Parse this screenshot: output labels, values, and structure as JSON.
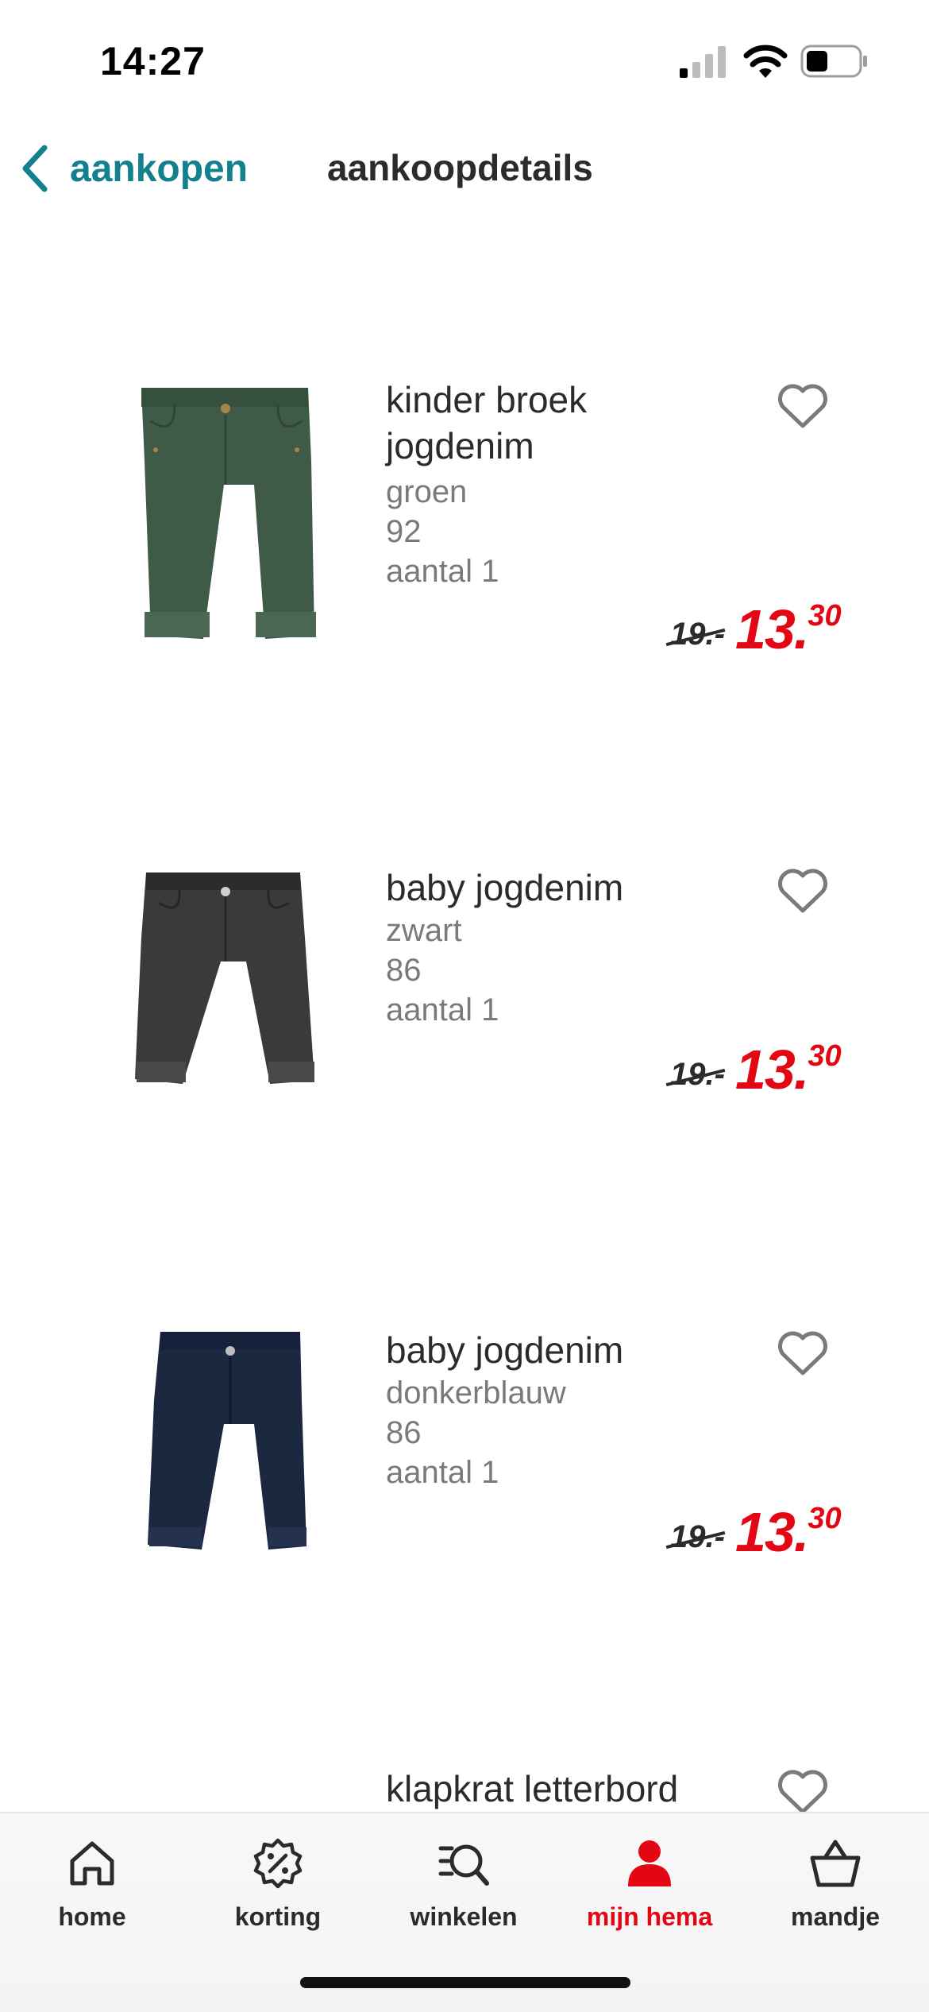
{
  "status_bar": {
    "time": "14:27"
  },
  "nav": {
    "back_label": "aankopen",
    "title": "aankoopdetails"
  },
  "items": [
    {
      "name": "kinder broek jogdenim",
      "color": "groen",
      "size": "92",
      "quantity": "aantal 1",
      "old_price": "19.-",
      "price_int": "13.",
      "price_dec": "30",
      "image": "green-jeans"
    },
    {
      "name": "baby jogdenim",
      "color": "zwart",
      "size": "86",
      "quantity": "aantal 1",
      "old_price": "19.-",
      "price_int": "13.",
      "price_dec": "30",
      "image": "black-jeans"
    },
    {
      "name": "baby jogdenim",
      "color": "donkerblauw",
      "size": "86",
      "quantity": "aantal 1",
      "old_price": "19.-",
      "price_int": "13.",
      "price_dec": "30",
      "image": "navy-jeans"
    },
    {
      "name": "klapkrat letterbord"
    }
  ],
  "tab_bar": {
    "tabs": [
      {
        "label": "home",
        "icon": "home-icon"
      },
      {
        "label": "korting",
        "icon": "discount-icon"
      },
      {
        "label": "winkelen",
        "icon": "search-list-icon"
      },
      {
        "label": "mijn hema",
        "icon": "user-icon",
        "active": true
      },
      {
        "label": "mandje",
        "icon": "basket-icon"
      }
    ]
  },
  "colors": {
    "accent": "#12808d",
    "price_red": "#e30613",
    "text": "#2b2b2b",
    "muted": "#7a7a7a"
  }
}
